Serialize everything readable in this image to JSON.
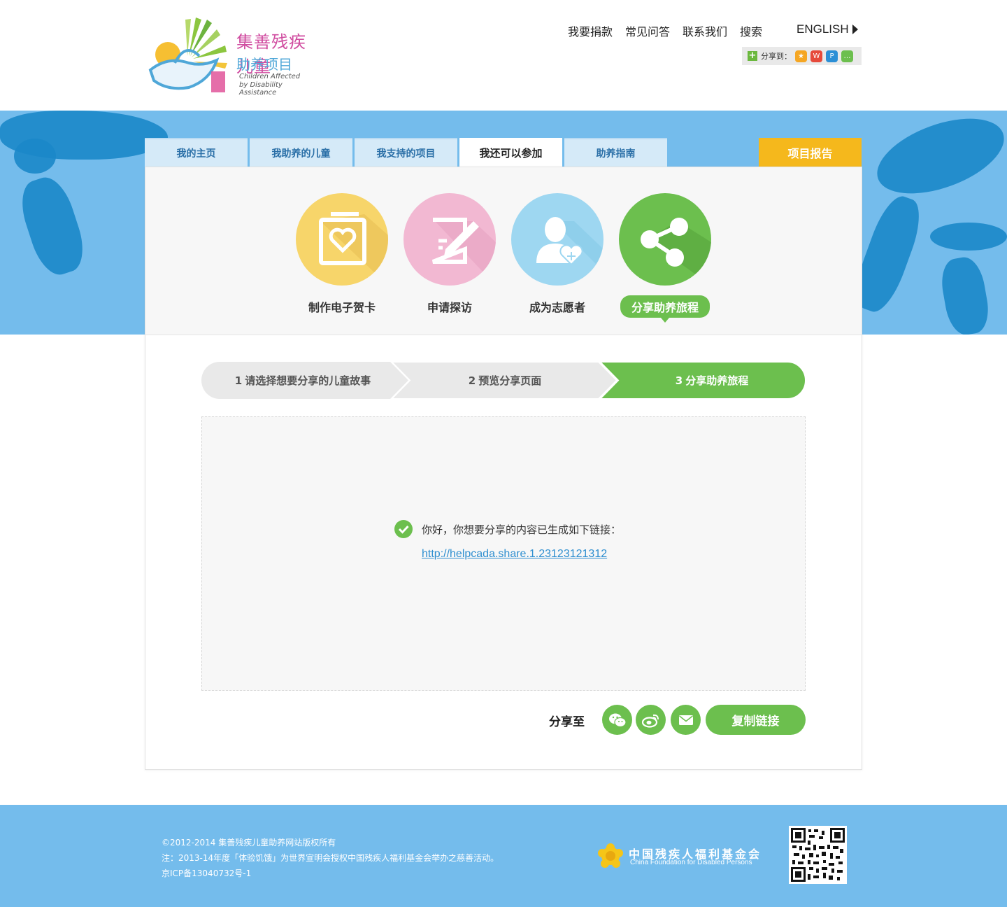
{
  "header": {
    "logo_cn_line1": "集善残疾儿童",
    "logo_cn_line2": "助养项目",
    "logo_en_line1": "Children Affected",
    "logo_en_line2": "by Disability Assistance",
    "nav": [
      "我要捐款",
      "常见问答",
      "联系我们",
      "搜索"
    ],
    "language": "ENGLISH",
    "share_label": "分享到："
  },
  "tabs": [
    {
      "label": "我的主页",
      "active": false
    },
    {
      "label": "我助养的儿童",
      "active": false
    },
    {
      "label": "我支持的项目",
      "active": false
    },
    {
      "label": "我还可以参加",
      "active": true
    },
    {
      "label": "助养指南",
      "active": false
    }
  ],
  "report_tab": "项目报告",
  "features": [
    {
      "label": "制作电子贺卡",
      "color": "#f7d56a",
      "icon": "card-heart-icon"
    },
    {
      "label": "申请探访",
      "color": "#f2b8d2",
      "icon": "edit-form-icon"
    },
    {
      "label": "成为志愿者",
      "color": "#9ed7f1",
      "icon": "volunteer-icon"
    },
    {
      "label": "分享助养旅程",
      "color": "#6cbf4e",
      "icon": "share-icon",
      "active": true
    }
  ],
  "steps": [
    {
      "num": "1",
      "label": "请选择想要分享的儿童故事"
    },
    {
      "num": "2",
      "label": "预览分享页面"
    },
    {
      "num": "3",
      "label": "分享助养旅程",
      "active": true
    }
  ],
  "result": {
    "message": "你好，你想要分享的内容已生成如下链接：",
    "link": "http://helpcada.share.1.23123121312"
  },
  "share": {
    "label": "分享至",
    "copy_button": "复制链接",
    "targets": [
      "wechat-icon",
      "weibo-icon",
      "email-icon"
    ]
  },
  "footer": {
    "copyright": "©2012-2014 集善残疾儿童助养网站版权所有",
    "note": "注：2013-14年度「体验饥饿」为世界宣明会授权中国残疾人福利基金会举办之慈善活动。",
    "icp": "京ICP备13040732号-1",
    "org_cn": "中国残疾人福利基金会",
    "org_en": "China Foundation for Disabled Persons"
  },
  "colors": {
    "accent_green": "#6cbf4e",
    "band_blue": "#74bcec",
    "report_yellow": "#f5b81c"
  }
}
